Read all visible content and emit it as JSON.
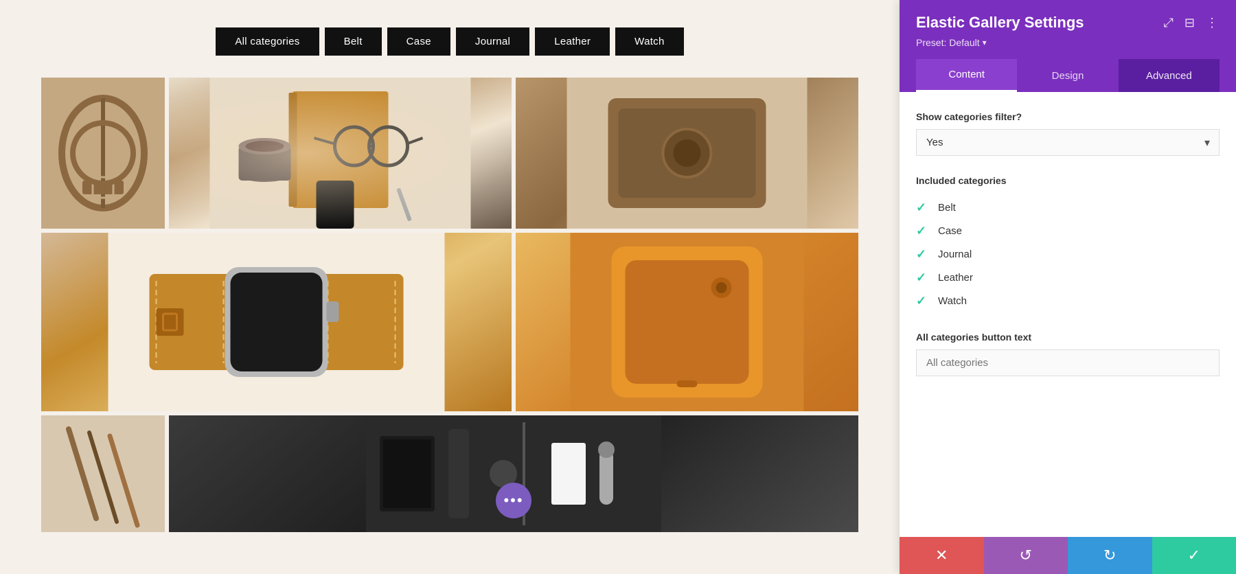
{
  "filterBar": {
    "buttons": [
      {
        "id": "all",
        "label": "All categories"
      },
      {
        "id": "belt",
        "label": "Belt"
      },
      {
        "id": "case",
        "label": "Case"
      },
      {
        "id": "journal",
        "label": "Journal"
      },
      {
        "id": "leather",
        "label": "Leather"
      },
      {
        "id": "watch",
        "label": "Watch"
      }
    ]
  },
  "panel": {
    "title": "Elastic Gallery Settings",
    "preset": "Preset: Default",
    "tabs": [
      {
        "id": "content",
        "label": "Content",
        "active": true
      },
      {
        "id": "design",
        "label": "Design",
        "active": false
      },
      {
        "id": "advanced",
        "label": "Advanced",
        "active": false
      }
    ],
    "showCategoriesFilter": {
      "label": "Show categories filter?",
      "value": "Yes"
    },
    "includedCategories": {
      "label": "Included categories",
      "items": [
        {
          "id": "belt",
          "label": "Belt",
          "checked": true
        },
        {
          "id": "case",
          "label": "Case",
          "checked": true
        },
        {
          "id": "journal",
          "label": "Journal",
          "checked": true
        },
        {
          "id": "leather",
          "label": "Leather",
          "checked": true
        },
        {
          "id": "watch",
          "label": "Watch",
          "checked": true
        }
      ]
    },
    "allCategoriesButton": {
      "label": "All categories button text",
      "placeholder": "All categories"
    },
    "actions": {
      "cancel": "✕",
      "undo": "↺",
      "redo": "↻",
      "confirm": "✓"
    }
  },
  "icons": {
    "expand": "⤢",
    "columns": "⊟",
    "more": "⋮",
    "checkmark": "✓",
    "threeDots": "•••"
  }
}
